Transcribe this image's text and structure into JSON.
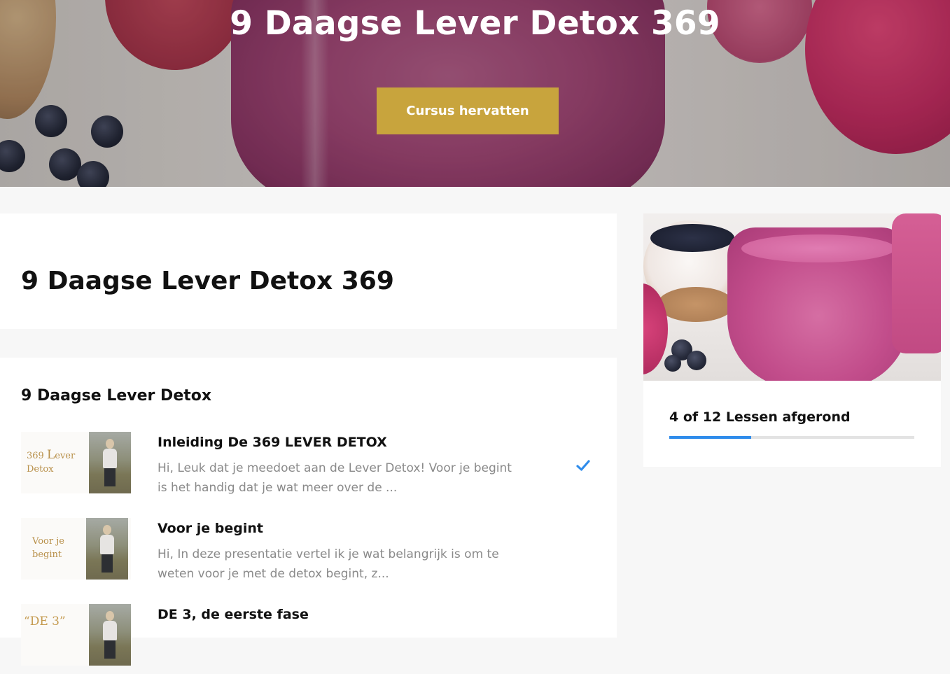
{
  "hero": {
    "title": "9 Daagse Lever Detox 369",
    "resume_button": "Cursus hervatten"
  },
  "course": {
    "title": "9 Daagse Lever Detox 369"
  },
  "section": {
    "title": "9 Daagse Lever Detox",
    "lessons": [
      {
        "thumb_text": [
          "369 ",
          "L",
          "ever",
          "Detox"
        ],
        "title": "Inleiding De 369 LEVER DETOX",
        "description": "Hi, Leuk dat je meedoet aan de Lever Detox! Voor je begint is het handig dat je wat meer over de ...",
        "completed": true,
        "icon": "checkmark-icon"
      },
      {
        "thumb_text": [
          "Voor je",
          "begint"
        ],
        "title": "Voor je begint",
        "description": "Hi, In deze presentatie vertel ik je wat belangrijk is om te weten voor je met de detox begint, z...",
        "completed": false
      },
      {
        "thumb_text": [
          "“DE 3”"
        ],
        "title": "DE 3, de eerste fase",
        "description": "",
        "completed": false
      }
    ]
  },
  "progress": {
    "label": "4 of 12 Lessen afgerond",
    "completed": 4,
    "total": 12,
    "fraction": 0.333
  },
  "colors": {
    "accent_button": "#c8a43d",
    "progress": "#2f8ceb",
    "check": "#2f8ceb",
    "thumb_text": "#b8904a"
  }
}
